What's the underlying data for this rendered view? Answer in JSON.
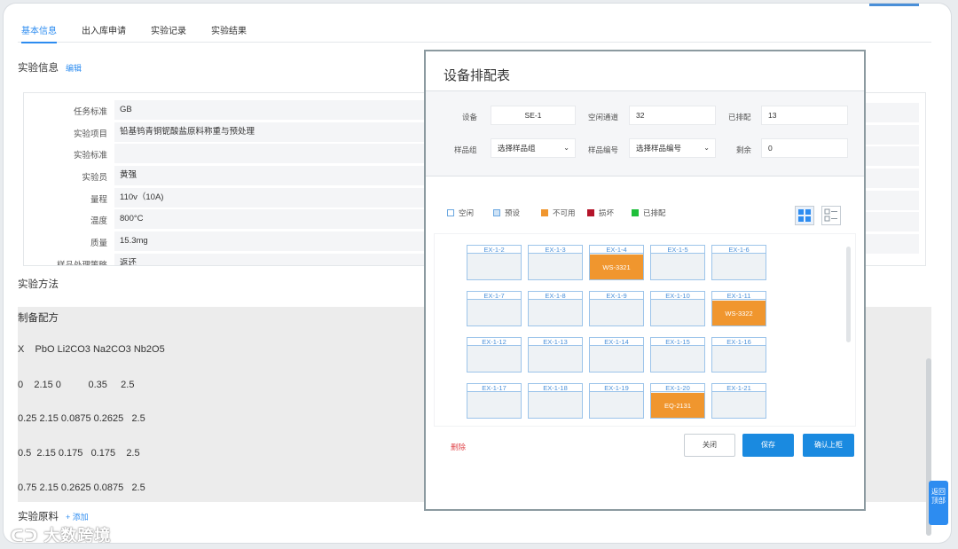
{
  "tabs": [
    "基本信息",
    "出入库申请",
    "实验记录",
    "实验结果"
  ],
  "info_section": {
    "title": "实验信息",
    "edit": "编辑"
  },
  "info_rows": [
    {
      "label": "任务标准",
      "value": "GB"
    },
    {
      "label": "实验项目",
      "value": "铅基钨青铜铌酸盐原料称重与预处理"
    },
    {
      "label": "实验标准",
      "value": ""
    },
    {
      "label": "实验员",
      "value": "黄强"
    },
    {
      "label": "量程",
      "value": "110v（10A)"
    },
    {
      "label": "温度",
      "value": "800°C"
    },
    {
      "label": "质量",
      "value": "15.3mg"
    },
    {
      "label": "样品处理策略",
      "value": "返还"
    }
  ],
  "method_title": "实验方法",
  "recipe": {
    "title": "制备配方",
    "lines": [
      "X    PbO Li2CO3 Na2CO3 Nb2O5",
      "0    2.15 0          0.35     2.5",
      "0.25 2.15 0.0875 0.2625   2.5",
      "0.5  2.15 0.175   0.175    2.5",
      "0.75 2.15 0.2625 0.0875   2.5"
    ]
  },
  "materials": {
    "title": "实验原料",
    "add": "+ 添加"
  },
  "side_button": "返回顶部",
  "watermark": "大数跨境",
  "modal": {
    "title": "设备排配表",
    "fields": {
      "device_label": "设备",
      "device_value": "SE-1",
      "channel_label": "空闲通道",
      "channel_value": "32",
      "assigned_label": "已排配",
      "assigned_value": "13",
      "group_label": "样品组",
      "group_value": "选择样品组",
      "code_label": "样品编号",
      "code_value": "选择样品编号",
      "remain_label": "剩余",
      "remain_value": "0"
    },
    "legend": [
      {
        "label": "空闲",
        "color": "#ffffff",
        "border": "#6aa7e0"
      },
      {
        "label": "预设",
        "color": "#cfe3f6",
        "border": "#6aa7e0"
      },
      {
        "label": "不可用",
        "color": "#f0962e",
        "border": "#f0962e"
      },
      {
        "label": "损坏",
        "color": "#b4142a",
        "border": "#b4142a"
      },
      {
        "label": "已排配",
        "color": "#1fbf3a",
        "border": "#1fbf3a"
      }
    ],
    "slots": [
      {
        "id": "EX-1-2",
        "sample": ""
      },
      {
        "id": "EX-1-3",
        "sample": ""
      },
      {
        "id": "EX-1-4",
        "sample": "WS-3321"
      },
      {
        "id": "EX-1-5",
        "sample": ""
      },
      {
        "id": "EX-1-6",
        "sample": ""
      },
      {
        "id": "EX-1-7",
        "sample": ""
      },
      {
        "id": "EX-1-8",
        "sample": ""
      },
      {
        "id": "EX-1-9",
        "sample": ""
      },
      {
        "id": "EX-1-10",
        "sample": ""
      },
      {
        "id": "EX-1-11",
        "sample": "WS-3322"
      },
      {
        "id": "EX-1-12",
        "sample": ""
      },
      {
        "id": "EX-1-13",
        "sample": ""
      },
      {
        "id": "EX-1-14",
        "sample": ""
      },
      {
        "id": "EX-1-15",
        "sample": ""
      },
      {
        "id": "EX-1-16",
        "sample": ""
      },
      {
        "id": "EX-1-17",
        "sample": ""
      },
      {
        "id": "EX-1-18",
        "sample": ""
      },
      {
        "id": "EX-1-19",
        "sample": ""
      },
      {
        "id": "EX-1-20",
        "sample": "EQ-2131"
      },
      {
        "id": "EX-1-21",
        "sample": ""
      }
    ],
    "delete": "删除",
    "buttons": {
      "close": "关闭",
      "save": "保存",
      "confirm": "确认上柜"
    },
    "view_icons": [
      "grid-view-icon",
      "list-view-icon"
    ]
  }
}
